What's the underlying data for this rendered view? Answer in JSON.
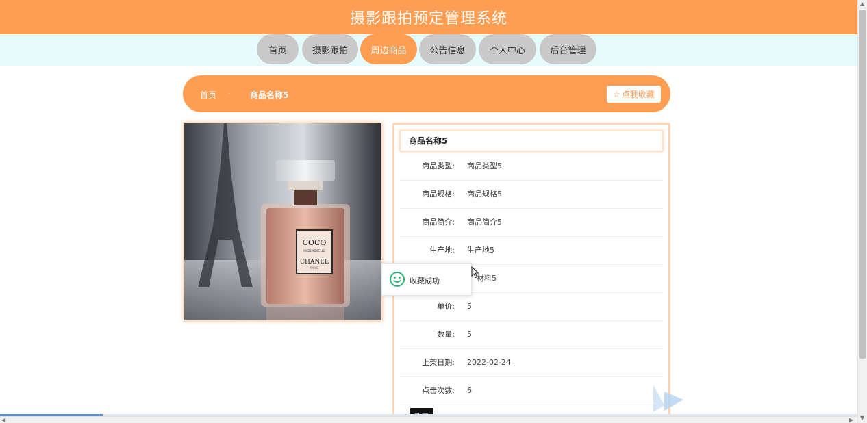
{
  "header": {
    "title": "摄影跟拍预定管理系统"
  },
  "nav": {
    "items": [
      {
        "label": "首页",
        "active": false
      },
      {
        "label": "摄影跟拍",
        "active": false
      },
      {
        "label": "周边商品",
        "active": true
      },
      {
        "label": "公告信息",
        "active": false
      },
      {
        "label": "个人中心",
        "active": false
      },
      {
        "label": "后台管理",
        "active": false
      }
    ]
  },
  "breadcrumb": {
    "home": "首页",
    "separator": "·",
    "current": "商品名称5",
    "favorite_label": "点我收藏",
    "favorite_icon": "star-outline-icon"
  },
  "product": {
    "image_text": {
      "brand_main": "COCO",
      "brand_sub": "MADEMOISELLE",
      "brand_name": "CHANEL",
      "brand_city": "PARIS"
    },
    "title": "商品名称5",
    "fields": [
      {
        "label": "商品类型:",
        "value": "商品类型5"
      },
      {
        "label": "商品规格:",
        "value": "商品规格5"
      },
      {
        "label": "商品简介:",
        "value": "商品简介5"
      },
      {
        "label": "生产地:",
        "value": "生产地5"
      },
      {
        "label": "",
        "value": "材料5"
      },
      {
        "label": "单价:",
        "value": "5"
      },
      {
        "label": "数量:",
        "value": "5"
      },
      {
        "label": "上架日期:",
        "value": "2022-02-24"
      },
      {
        "label": "点击次数:",
        "value": "6"
      }
    ]
  },
  "toast": {
    "message": "收藏成功",
    "icon": "smile-icon"
  },
  "buy_button": {
    "label": "购买"
  },
  "colors": {
    "accent": "#ff9d52",
    "nav_bg": "#e6fbfb",
    "nav_inactive": "#c9c9c9",
    "panel_border": "#ffd3b4",
    "toast_icon": "#2bb673"
  }
}
